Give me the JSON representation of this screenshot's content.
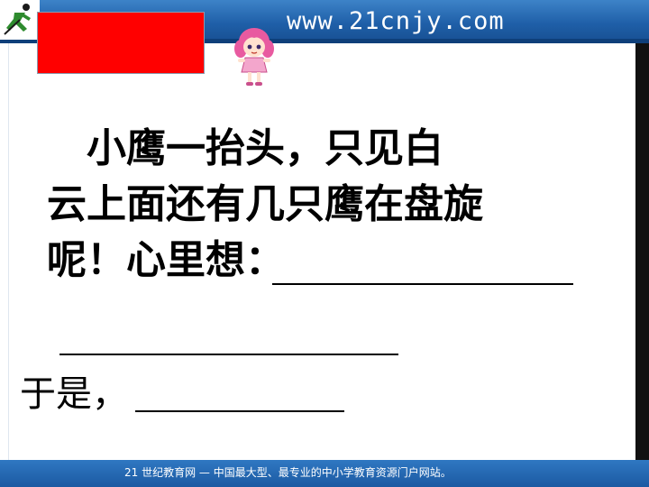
{
  "header": {
    "site_url": "www.21cnjy.com"
  },
  "passage": {
    "lines": [
      "　小鹰一抬头，只见白",
      "云上面还有几只鹰在盘旋",
      "呢！心里想："
    ],
    "continuation": "于是，"
  },
  "footer": {
    "text": "21 世纪教育网 — 中国最大型、最专业的中小学教育资源门户网站。"
  },
  "colors": {
    "header_blue": "#1f5fa8",
    "red_box": "#ff0000",
    "text": "#000000"
  },
  "icons": [
    "running-person-logo-icon",
    "cartoon-girl-icon"
  ]
}
